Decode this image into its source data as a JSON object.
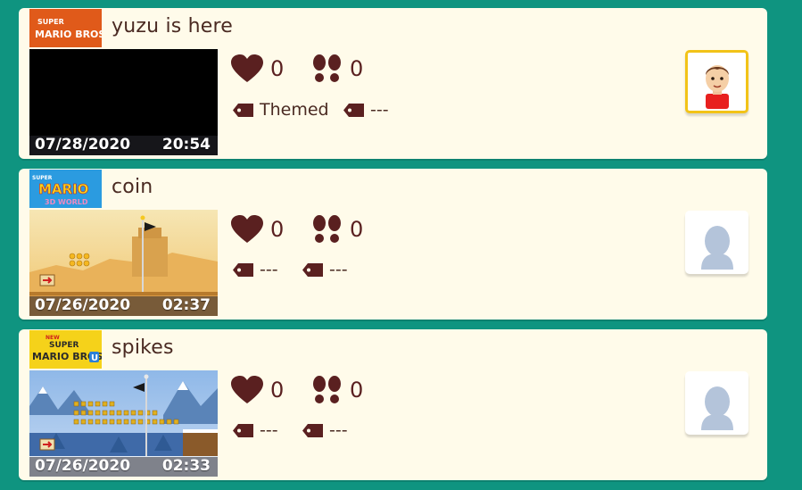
{
  "courses": [
    {
      "style_logo_text": [
        "SUPER",
        "MARIO BROS."
      ],
      "title": "yuzu is here",
      "thumbnail_date": "07/28/2020",
      "thumbnail_time": "20:54",
      "likes": "0",
      "plays": "0",
      "tag1": "Themed",
      "tag2": "---",
      "avatar": "mii"
    },
    {
      "style_logo_text": [
        "SUPER",
        "MARIO",
        "3D WORLD"
      ],
      "title": "coin",
      "thumbnail_date": "07/26/2020",
      "thumbnail_time": "02:37",
      "likes": "0",
      "plays": "0",
      "tag1": "---",
      "tag2": "---",
      "avatar": "placeholder"
    },
    {
      "style_logo_text": [
        "NEW",
        "SUPER",
        "MARIO BROS.",
        "U"
      ],
      "title": "spikes",
      "thumbnail_date": "07/26/2020",
      "thumbnail_time": "02:33",
      "likes": "0",
      "plays": "0",
      "tag1": "---",
      "tag2": "---",
      "avatar": "placeholder"
    }
  ],
  "icons": {
    "like": "heart-icon",
    "plays": "footprints-icon",
    "tag": "tag-icon"
  },
  "colors": {
    "background": "#0f9480",
    "card": "#fffbea",
    "text": "#4a2a22",
    "icon": "#5a2020",
    "avatar_selected_border": "#f2c318"
  }
}
